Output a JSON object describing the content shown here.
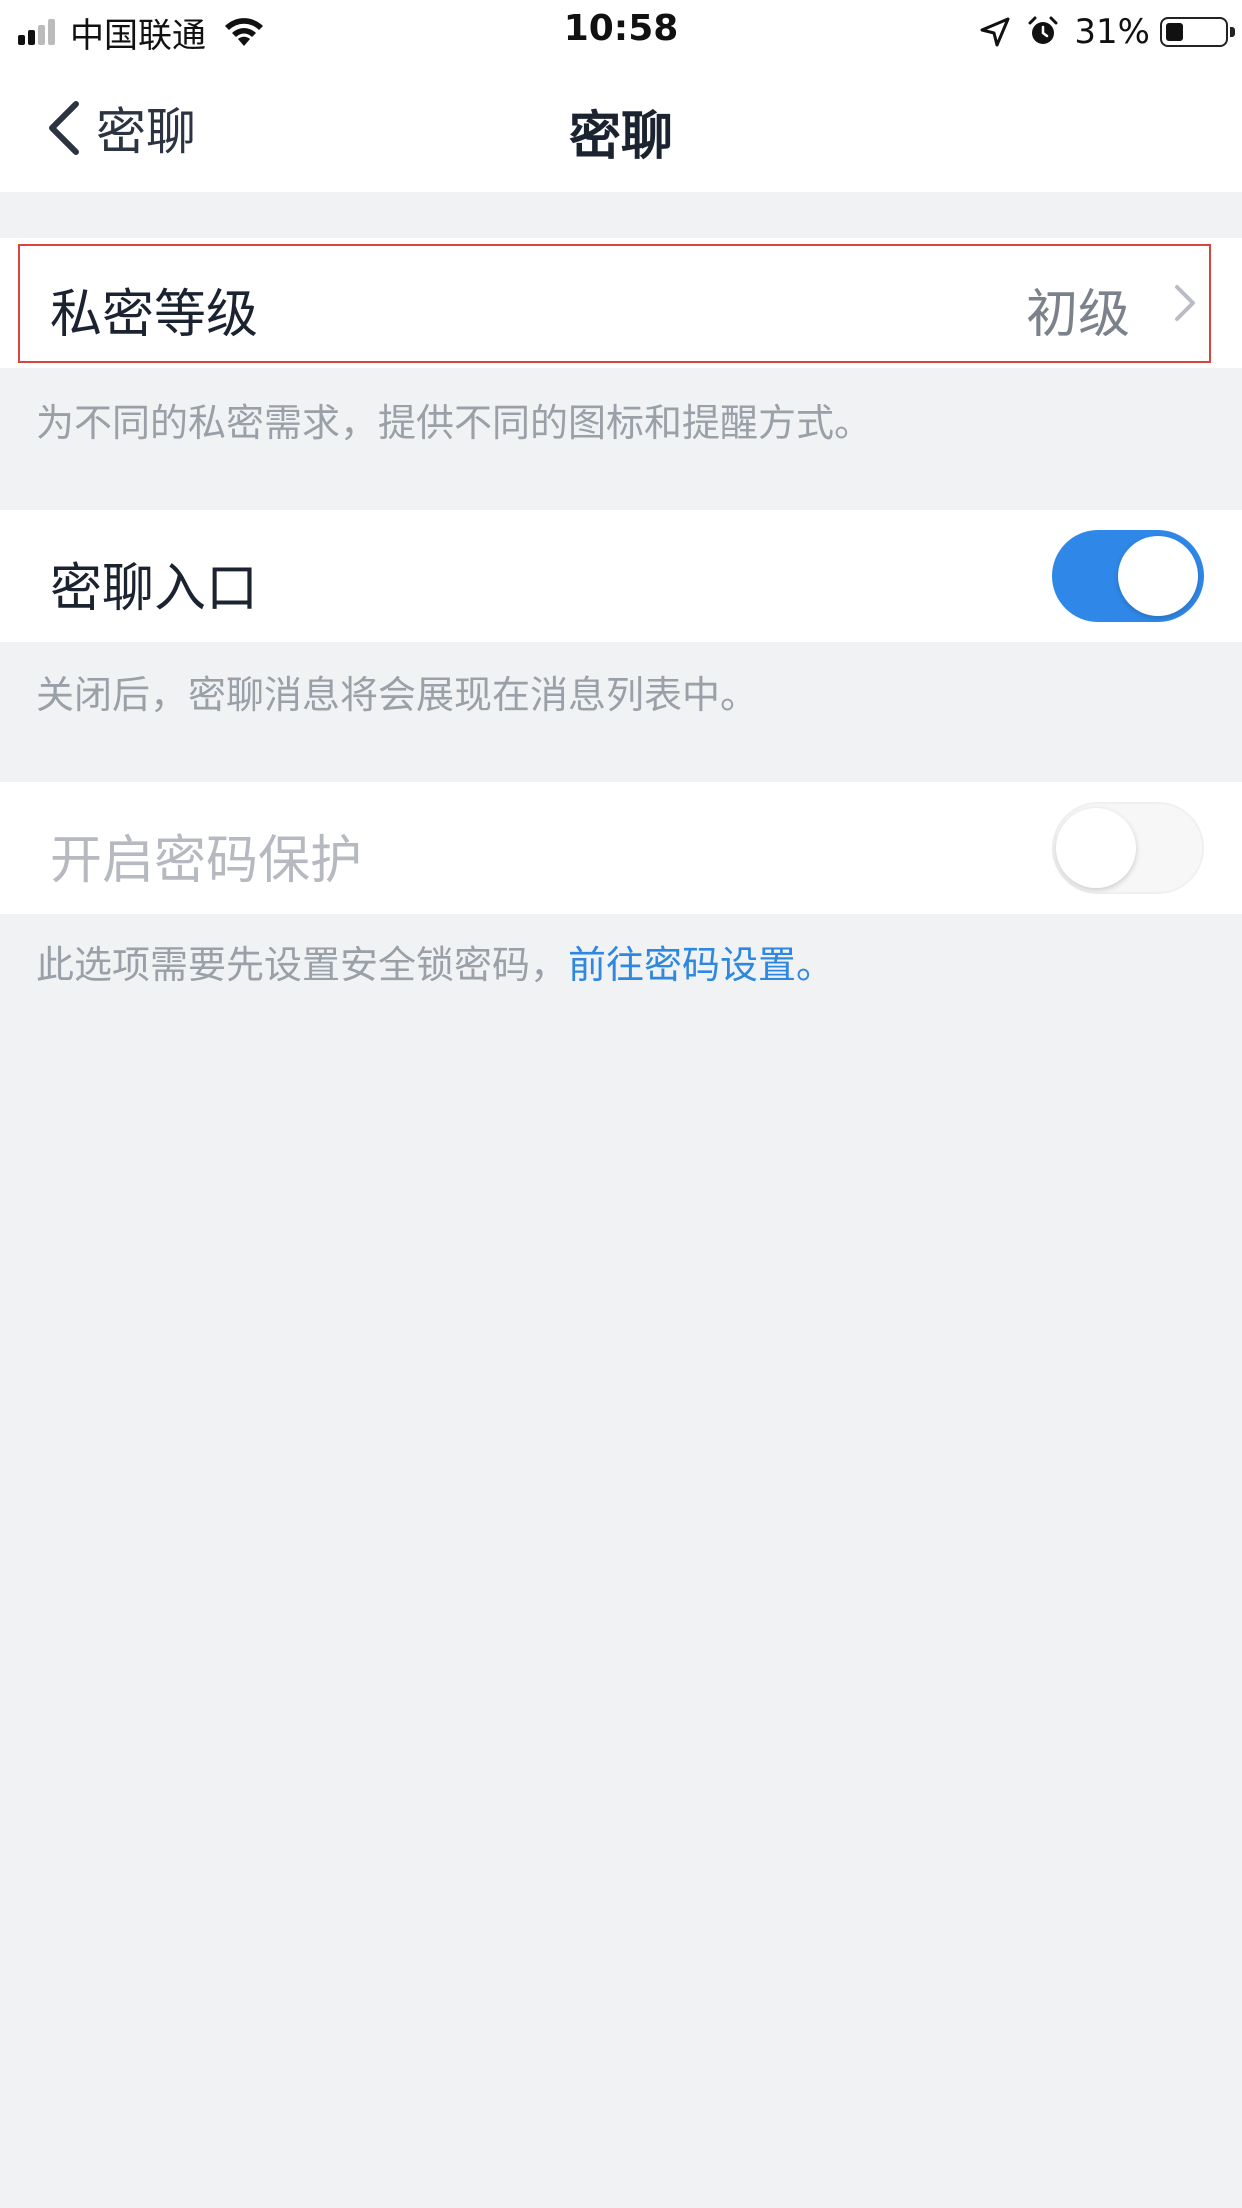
{
  "status_bar": {
    "carrier": "中国联通",
    "time": "10:58",
    "battery_percent": "31%",
    "battery_level": 0.31,
    "icons": [
      "signal-icon",
      "wifi-icon",
      "location-arrow-icon",
      "alarm-icon",
      "battery-icon"
    ]
  },
  "nav": {
    "back_label": "密聊",
    "title": "密聊"
  },
  "privacy_level": {
    "label": "私密等级",
    "value": "初级",
    "hint": "为不同的私密需求，提供不同的图标和提醒方式。"
  },
  "secret_chat_entry": {
    "label": "密聊入口",
    "enabled": true,
    "hint": "关闭后，密聊消息将会展现在消息列表中。"
  },
  "password_protection": {
    "label": "开启密码保护",
    "enabled": false,
    "disabled": true,
    "hint_prefix": "此选项需要先设置安全锁密码，",
    "hint_link": "前往密码设置。"
  },
  "colors": {
    "accent": "#2f88e8",
    "link": "#2f88e0",
    "background": "#f1f2f4",
    "highlight_border": "#d9453e"
  }
}
